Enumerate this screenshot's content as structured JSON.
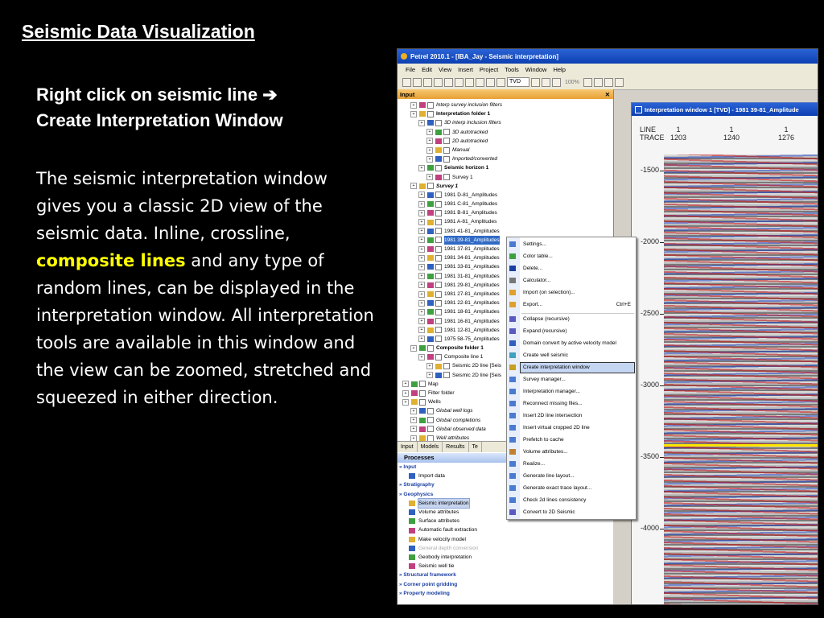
{
  "slide": {
    "title": "Seismic Data Visualization",
    "subhead_line1": "Right click on seismic line ➔",
    "subhead_line2": "Create Interpretation Window",
    "body_p1": "The seismic interpretation window gives you a classic 2D view of the seismic data. Inline, crossline, ",
    "body_highlight": "composite lines",
    "body_p2": " and any type of random lines, can be displayed in the interpretation window. All interpretation tools are available in this window and the view can be zoomed, stretched and squeezed in either direction.",
    "highlight_color": "#ffff00"
  },
  "app": {
    "title": "Petrel 2010.1 - [IBA_Jay - Seismic interpretation]",
    "menus": [
      "File",
      "Edit",
      "View",
      "Insert",
      "Project",
      "Tools",
      "Window",
      "Help"
    ],
    "domain_select": "TVD",
    "zoom": "100%"
  },
  "input_panel": {
    "title": "Input",
    "tree": [
      {
        "label": "Interp survey inclusion filters",
        "indent": 1,
        "italic": true
      },
      {
        "label": "Interpretation folder 1",
        "indent": 1,
        "bold": true
      },
      {
        "label": "3D interp inclusion filters",
        "indent": 2,
        "italic": true
      },
      {
        "label": "3D autotracked",
        "indent": 3,
        "italic": true
      },
      {
        "label": "2D autotracked",
        "indent": 3,
        "italic": true
      },
      {
        "label": "Manual",
        "indent": 3,
        "italic": true
      },
      {
        "label": "Imported/converted",
        "indent": 3,
        "italic": true
      },
      {
        "label": "Seismic horizon 1",
        "indent": 2,
        "bold": true
      },
      {
        "label": "Survey 1",
        "indent": 3
      },
      {
        "label": "Survey 1",
        "indent": 1,
        "bold": true,
        "italic": true
      },
      {
        "label": "1981 D-81_Amplitudes",
        "indent": 2
      },
      {
        "label": "1981 C-81_Amplitudes",
        "indent": 2
      },
      {
        "label": "1981 B-81_Amplitudes",
        "indent": 2
      },
      {
        "label": "1981 A-81_Amplitudes",
        "indent": 2
      },
      {
        "label": "1981 41-81_Amplitudes",
        "indent": 2
      },
      {
        "label": "1981 39-81_Amplitudes",
        "indent": 2,
        "selected": true
      },
      {
        "label": "1981 37-81_Amplitudes",
        "indent": 2
      },
      {
        "label": "1981 34-81_Amplitudes",
        "indent": 2
      },
      {
        "label": "1981 33-81_Amplitudes",
        "indent": 2
      },
      {
        "label": "1981 31-81_Amplitudes",
        "indent": 2
      },
      {
        "label": "1981 29-81_Amplitudes",
        "indent": 2
      },
      {
        "label": "1981 27-81_Amplitudes",
        "indent": 2
      },
      {
        "label": "1981 22-81_Amplitudes",
        "indent": 2
      },
      {
        "label": "1981 18-81_Amplitudes",
        "indent": 2
      },
      {
        "label": "1981 16-81_Amplitudes",
        "indent": 2
      },
      {
        "label": "1981 12-81_Amplitudes",
        "indent": 2
      },
      {
        "label": "1975 58-75_Amplitudes",
        "indent": 2
      },
      {
        "label": "Composite folder 1",
        "indent": 1,
        "bold": true
      },
      {
        "label": "Composite line 1",
        "indent": 2
      },
      {
        "label": "Seismic 2D line [Seis",
        "indent": 3
      },
      {
        "label": "Seismic 2D line [Seis",
        "indent": 3
      },
      {
        "label": "Map",
        "indent": 0
      },
      {
        "label": "Filter folder",
        "indent": 0
      },
      {
        "label": "Wells",
        "indent": 0
      },
      {
        "label": "Global well logs",
        "indent": 1,
        "italic": true
      },
      {
        "label": "Global completions",
        "indent": 1,
        "italic": true
      },
      {
        "label": "Global observed data",
        "indent": 1,
        "italic": true
      },
      {
        "label": "Well attributes",
        "indent": 1,
        "italic": true
      }
    ],
    "tabs": [
      "Input",
      "Models",
      "Results",
      "Te"
    ]
  },
  "processes": {
    "title": "Processes",
    "items": [
      {
        "label": "Input",
        "type": "cat"
      },
      {
        "label": "Import data",
        "type": "proc"
      },
      {
        "label": "Stratigraphy",
        "type": "cat"
      },
      {
        "label": "Geophysics",
        "type": "cat"
      },
      {
        "label": "Seismic interpretation",
        "type": "proc",
        "current": true
      },
      {
        "label": "Volume attributes",
        "type": "proc"
      },
      {
        "label": "Surface attributes",
        "type": "proc"
      },
      {
        "label": "Automatic fault extraction",
        "type": "proc"
      },
      {
        "label": "Make velocity model",
        "type": "proc"
      },
      {
        "label": "General depth conversion",
        "type": "proc",
        "disabled": true
      },
      {
        "label": "Geobody interpretation",
        "type": "proc"
      },
      {
        "label": "Seismic well tie",
        "type": "proc"
      },
      {
        "label": "Structural framework",
        "type": "cat"
      },
      {
        "label": "Corner point gridding",
        "type": "cat"
      },
      {
        "label": "Property modeling",
        "type": "cat"
      }
    ]
  },
  "interp_window": {
    "title": "Interpretation window 1 [TVD] - 1981 39-81_Amplitude",
    "line_label": "LINE",
    "trace_label": "TRACE",
    "columns": [
      {
        "line": "1",
        "trace": "1203"
      },
      {
        "line": "1",
        "trace": "1240"
      },
      {
        "line": "1",
        "trace": "1276"
      }
    ],
    "depth_ticks": [
      "-1500",
      "-2000",
      "-2500",
      "-3000",
      "-3500",
      "-4000"
    ]
  },
  "context_menu": {
    "items": [
      {
        "label": "Settings...",
        "icon": "settings-icon"
      },
      {
        "label": "Color table...",
        "icon": "color-table-icon"
      },
      {
        "label": "Delete...",
        "icon": "delete-icon"
      },
      {
        "label": "Calculator...",
        "icon": "calculator-icon"
      },
      {
        "label": "Import (on selection)...",
        "icon": "import-icon"
      },
      {
        "label": "Export...",
        "shortcut": "Ctrl+E",
        "icon": "export-icon"
      },
      {
        "sep": true
      },
      {
        "label": "Collapse (recursive)",
        "icon": "collapse-icon"
      },
      {
        "label": "Expand (recursive)",
        "icon": "expand-icon"
      },
      {
        "label": "Domain convert by active velocity model",
        "icon": "domain-convert-icon"
      },
      {
        "label": "Create well seismic",
        "icon": "well-seismic-icon"
      },
      {
        "label": "Create interpretation window",
        "icon": "interp-window-icon",
        "hover": true
      },
      {
        "label": "Survey manager...",
        "icon": "survey-manager-icon"
      },
      {
        "label": "Interpretation manager...",
        "icon": "interp-manager-icon"
      },
      {
        "label": "Reconnect missing files...",
        "icon": "reconnect-icon"
      },
      {
        "label": "Insert 2D line intersection",
        "icon": "intersection-icon"
      },
      {
        "label": "Insert virtual cropped 2D line",
        "icon": "cropped-line-icon"
      },
      {
        "label": "Prefetch to cache",
        "icon": "cache-icon"
      },
      {
        "label": "Volume attributes...",
        "icon": "volume-attr-icon"
      },
      {
        "label": "Realize...",
        "icon": "realize-icon"
      },
      {
        "label": "Generate line layout...",
        "icon": "line-layout-icon"
      },
      {
        "label": "Generate exact trace layout...",
        "icon": "trace-layout-icon"
      },
      {
        "label": "Check 2d lines consistency",
        "icon": "consistency-icon"
      },
      {
        "label": "Convert to 2D Seismic",
        "icon": "convert-2d-icon"
      }
    ]
  }
}
